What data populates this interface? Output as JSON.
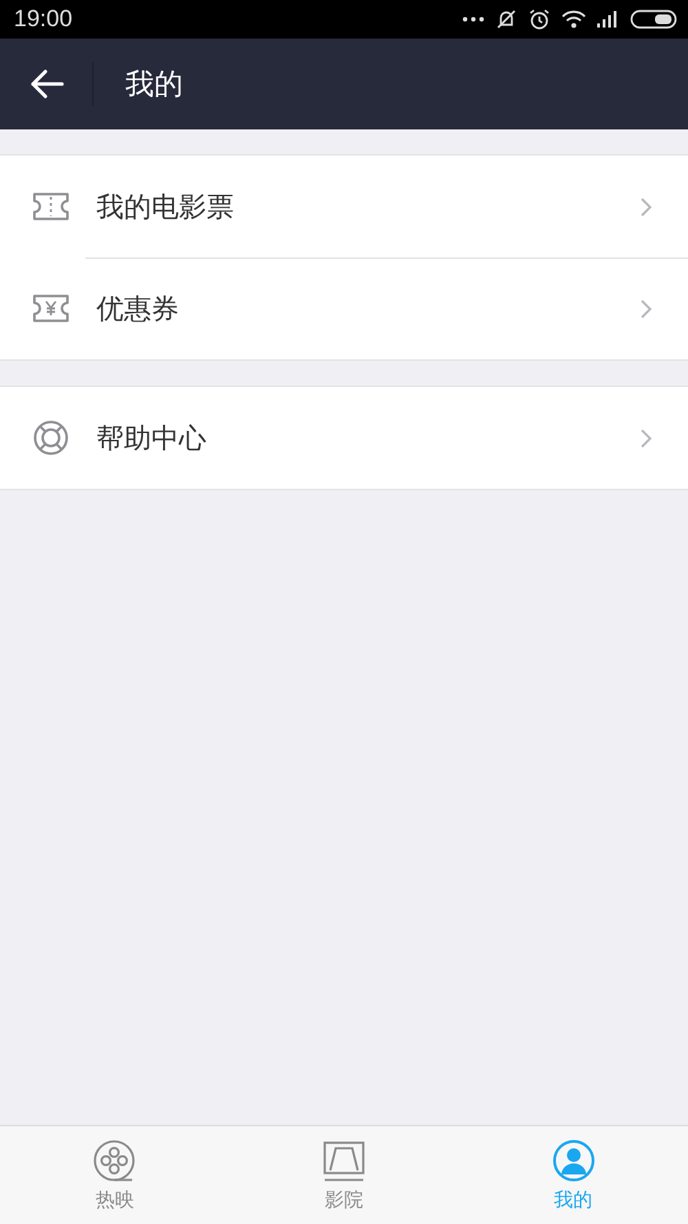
{
  "status_bar": {
    "time": "19:00"
  },
  "header": {
    "title": "我的"
  },
  "sections": [
    {
      "items": [
        {
          "kind": "ticket",
          "label": "我的电影票"
        },
        {
          "kind": "coupon",
          "label": "优惠券"
        }
      ]
    },
    {
      "items": [
        {
          "kind": "help",
          "label": "帮助中心"
        }
      ]
    }
  ],
  "tab_bar": [
    {
      "kind": "film",
      "label": "热映",
      "selected": false
    },
    {
      "kind": "cinema",
      "label": "影院",
      "selected": false
    },
    {
      "kind": "user",
      "label": "我的",
      "selected": true
    }
  ]
}
